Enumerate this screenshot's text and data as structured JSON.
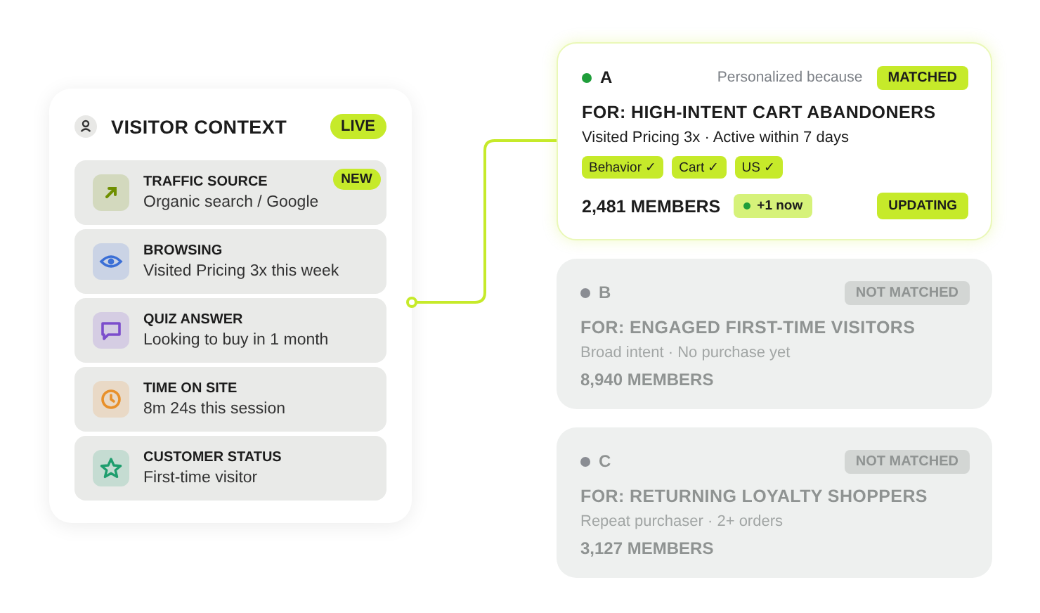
{
  "context": {
    "title": "VISITOR CONTEXT",
    "badge": "LIVE",
    "items": [
      {
        "kind": "arrow",
        "color": "#6f8f00",
        "label": "TRAFFIC SOURCE",
        "value": "Organic search / Google",
        "badge": "NEW"
      },
      {
        "kind": "eye",
        "color": "#3b6fd6",
        "label": "BROWSING",
        "value": "Visited Pricing 3x this week"
      },
      {
        "kind": "chat",
        "color": "#7c4dcc",
        "label": "QUIZ ANSWER",
        "value": "Looking to buy in 1 month"
      },
      {
        "kind": "clock",
        "color": "#e8902a",
        "label": "TIME ON SITE",
        "value": "8m 24s this session"
      },
      {
        "kind": "star",
        "color": "#1f9e6e",
        "label": "CUSTOMER STATUS",
        "value": "First-time visitor"
      }
    ]
  },
  "segments": [
    {
      "letter": "A",
      "matched": true,
      "reason": "Personalized because",
      "status": "MATCHED",
      "title": "FOR: HIGH-INTENT CART ABANDONERS",
      "subtitle": "Visited Pricing 3x · Active within 7 days",
      "tags": [
        "Behavior ✓",
        "Cart ✓",
        "US ✓"
      ],
      "members": "2,481 MEMBERS",
      "live": "+1 now",
      "state": "UPDATING"
    },
    {
      "letter": "B",
      "matched": false,
      "status": "NOT MATCHED",
      "title": "FOR: ENGAGED FIRST-TIME VISITORS",
      "subtitle": "Broad intent · No purchase yet",
      "members": "8,940 MEMBERS"
    },
    {
      "letter": "C",
      "matched": false,
      "status": "NOT MATCHED",
      "title": "FOR: RETURNING LOYALTY SHOPPERS",
      "subtitle": "Repeat purchaser · 2+ orders",
      "members": "3,127 MEMBERS"
    }
  ]
}
